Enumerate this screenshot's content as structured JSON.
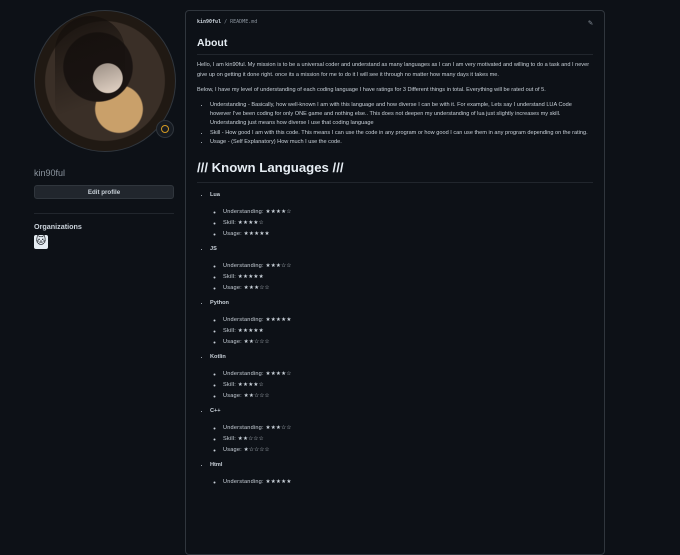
{
  "profile": {
    "username": "kin90ful",
    "edit_label": "Edit profile",
    "organizations_label": "Organizations",
    "org_icon": "cat-icon",
    "status_color": "#d29922"
  },
  "readme": {
    "path_user": "kin90ful",
    "path_sep": "/",
    "path_file": "README.md",
    "about_heading": "About",
    "intro": "Hello, I am kin90ful. My mission is to be a universal coder and understand as many languages as I can I am very motivated and willing to do a task and I never give up on getting it done right. once its a mission for me to do it I will see it through no matter how many days it takes me.",
    "ratings_intro": "Below, I have my level of understanding of each coding language I have ratings for 3 Different things in total. Everything will be rated out of 5.",
    "bullets": [
      "Understanding - Basically, how well-known I am with this language and how diverse I can be with it. For example, Lets say I understand LUA Code however I've been coding for only ONE game and nothing else.. This does not deepen my understanding of lua just slightly increases my skill. Understanding just means how diverse I use that coding language",
      "Skill - How good I am with this code. This means I can use the code in any program or how good I can use them in any program depending on the rating.",
      "Usage - (Self Explanatory) How much I use the code."
    ],
    "known_heading": "/// Known Languages ///",
    "languages": [
      {
        "name": "Lua",
        "understanding": "Understanding: ★★★★☆",
        "skill": "Skill: ★★★★☆",
        "usage": "Usage: ★★★★★"
      },
      {
        "name": "JS",
        "understanding": "Understanding: ★★★☆☆",
        "skill": "Skill: ★★★★★",
        "usage": "Usage: ★★★☆☆"
      },
      {
        "name": "Python",
        "understanding": "Understanding: ★★★★★",
        "skill": "Skill: ★★★★★",
        "usage": "Usage: ★★☆☆☆"
      },
      {
        "name": "Kotlin",
        "understanding": "Understanding: ★★★★☆",
        "skill": "Skill: ★★★★☆",
        "usage": "Usage: ★★☆☆☆"
      },
      {
        "name": "C++",
        "understanding": "Understanding: ★★★☆☆",
        "skill": "Skill: ★★☆☆☆",
        "usage": "Usage: ★☆☆☆☆"
      },
      {
        "name": "Html",
        "understanding": "Understanding: ★★★★★",
        "skill": "",
        "usage": ""
      }
    ]
  }
}
